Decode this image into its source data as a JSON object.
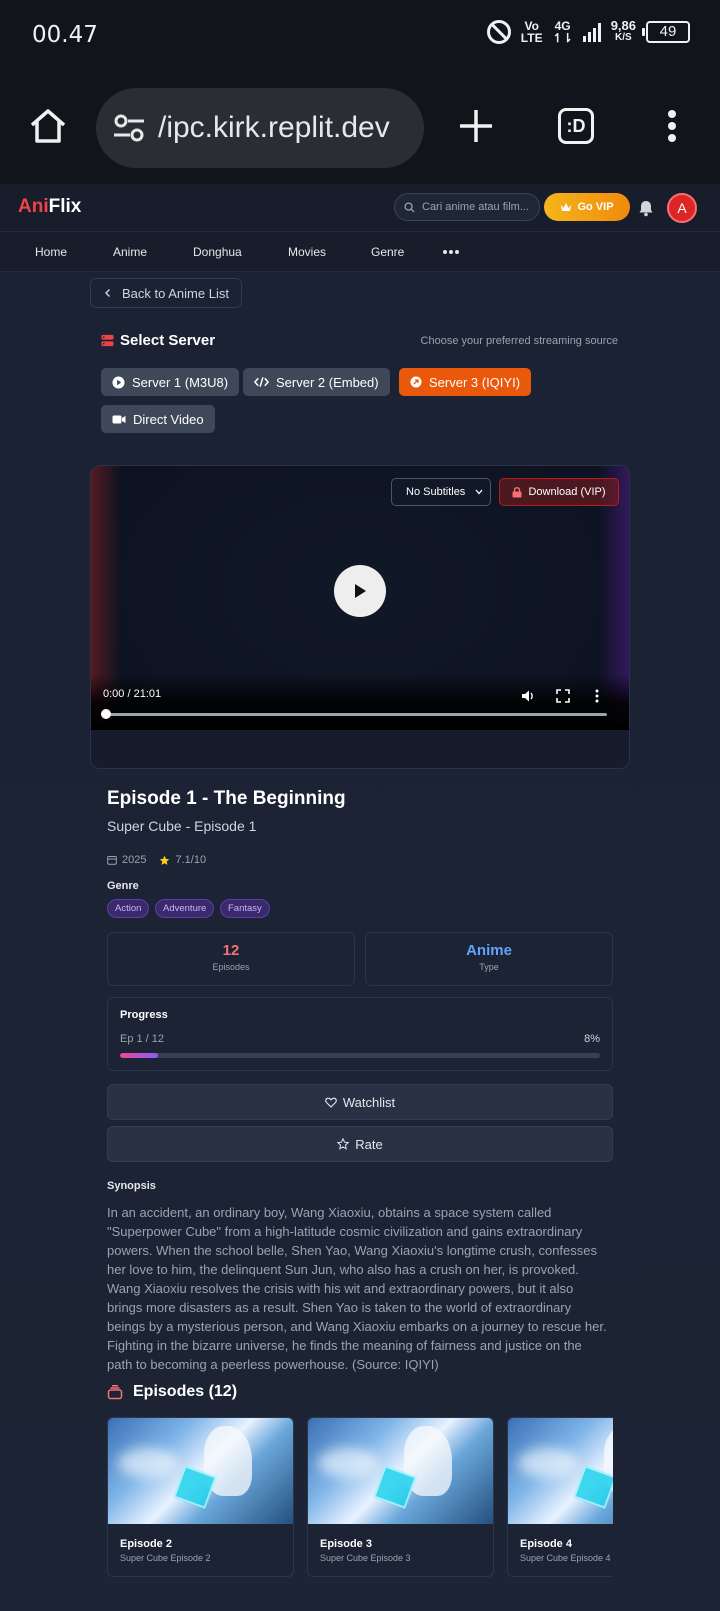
{
  "status_bar": {
    "time": "00.47",
    "network_top": "Vo",
    "network_bottom": "LTE",
    "gen_top": "4G",
    "gen_bottom": "↿⇂",
    "speed_top": "9,86",
    "speed_bottom": "K/S",
    "battery": "49"
  },
  "browser": {
    "url": "/ipc.kirk.replit.dev",
    "tabs_label": ":D"
  },
  "header": {
    "logo_part1": "Ani",
    "logo_part2": "Flix",
    "search_placeholder": "Cari anime atau film...",
    "vip_label": "Go VIP",
    "avatar_initial": "A"
  },
  "nav": {
    "items": [
      {
        "label": "Home"
      },
      {
        "label": "Anime"
      },
      {
        "label": "Donghua"
      },
      {
        "label": "Movies"
      },
      {
        "label": "Genre"
      }
    ]
  },
  "back_label": "Back to Anime List",
  "server_section": {
    "title": "Select Server",
    "hint": "Choose your preferred streaming source",
    "servers": [
      {
        "label": "Server 1 (M3U8)",
        "active": false
      },
      {
        "label": "Server 2 (Embed)",
        "active": false
      },
      {
        "label": "Server 3 (IQIYI)",
        "active": true
      },
      {
        "label": "Direct Video",
        "active": false
      }
    ]
  },
  "player": {
    "subtitle_value": "No Subtitles",
    "download_label": "Download (VIP)",
    "time": "0:00 / 21:01",
    "played_fraction": 0.0
  },
  "episode": {
    "title": "Episode 1 - The Beginning",
    "subtitle": "Super Cube - Episode 1",
    "year": "2025",
    "rating": "7.1/10",
    "genre_label": "Genre",
    "genres": [
      "Action",
      "Adventure",
      "Fantasy"
    ]
  },
  "stats": {
    "episodes_value": "12",
    "episodes_label": "Episodes",
    "type_value": "Anime",
    "type_label": "Type"
  },
  "progress": {
    "title": "Progress",
    "episode_text": "Ep 1 / 12",
    "percent_text": "8%",
    "percent": 8
  },
  "actions": {
    "watchlist": "Watchlist",
    "rate": "Rate"
  },
  "synopsis": {
    "title": "Synopsis",
    "text": "In an accident, an ordinary boy, Wang Xiaoxiu, obtains a space system called \"Superpower Cube\" from a high-latitude cosmic civilization and gains extraordinary powers. When the school belle, Shen Yao, Wang Xiaoxiu's longtime crush, confesses her love to him, the delinquent Sun Jun, who also has a crush on her, is provoked. Wang Xiaoxiu resolves the crisis with his wit and extraordinary powers, but it also brings more disasters as a result. Shen Yao is taken to the world of extraordinary beings by a mysterious person, and Wang Xiaoxiu embarks on a journey to rescue her. Fighting in the bizarre universe, he finds the meaning of fairness and justice on the path to becoming a peerless powerhouse. (Source: IQIYI)"
  },
  "episodes": {
    "heading": "Episodes (12)",
    "items": [
      {
        "name": "Episode 2",
        "desc": "Super Cube Episode 2"
      },
      {
        "name": "Episode 3",
        "desc": "Super Cube Episode 3"
      },
      {
        "name": "Episode 4",
        "desc": "Super Cube Episode 4"
      }
    ]
  },
  "colors": {
    "accent_orange": "#ea580c",
    "brand_red": "#ef4444",
    "vip_gold": "#f5b51b",
    "episodes_stat": "#f87171",
    "type_stat": "#60a5fa"
  }
}
